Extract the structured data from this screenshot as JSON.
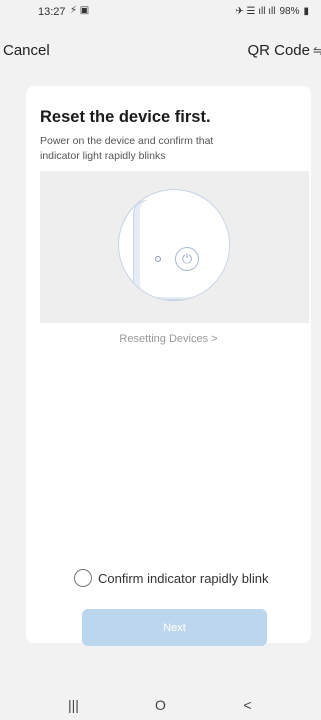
{
  "status_bar": {
    "time": "13:27",
    "left_icons": "⚡ ▣",
    "right_icons": "✈ ☰ ıll ıll",
    "battery": "98%"
  },
  "header": {
    "cancel_label": "Cancel",
    "qr_label": "QR Code",
    "qr_icon": "swap-icon"
  },
  "card": {
    "title": "Reset the device first.",
    "description": "Power on the device and confirm that indicator light rapidly blinks",
    "resetting_link": "Resetting Devices >",
    "confirm_label": "Confirm indicator rapidly blink",
    "next_label": "Next",
    "next_color": "#bcd6ee"
  },
  "nav_bar": {
    "recents": "|||",
    "home": "O",
    "back": "<"
  }
}
